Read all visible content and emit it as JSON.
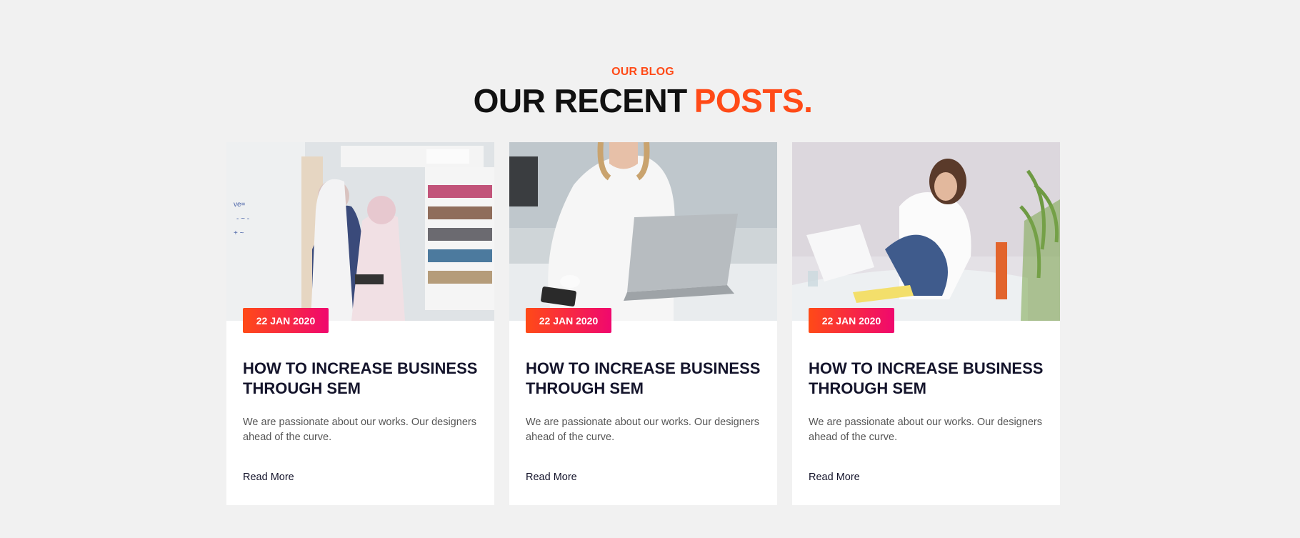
{
  "section": {
    "eyebrow": "OUR BLOG",
    "heading_main": "OUR RECENT",
    "heading_accent": "POSTS."
  },
  "colors": {
    "accent": "#ff4a17",
    "badge_start": "#ff4a17",
    "badge_end": "#f0086e",
    "background": "#f1f1f1",
    "title": "#14142b"
  },
  "posts": [
    {
      "date": "22 JAN 2020",
      "title": "HOW TO INCREASE BUSINESS THROUGH SEM",
      "excerpt": "We are passionate about our works. Our designers ahead of the curve.",
      "link": "Read More"
    },
    {
      "date": "22 JAN 2020",
      "title": "HOW TO INCREASE BUSINESS THROUGH SEM",
      "excerpt": "We are passionate about our works. Our designers ahead of the curve.",
      "link": "Read More"
    },
    {
      "date": "22 JAN 2020",
      "title": "HOW TO INCREASE BUSINESS THROUGH SEM",
      "excerpt": "We are passionate about our works. Our designers ahead of the curve.",
      "link": "Read More"
    }
  ]
}
